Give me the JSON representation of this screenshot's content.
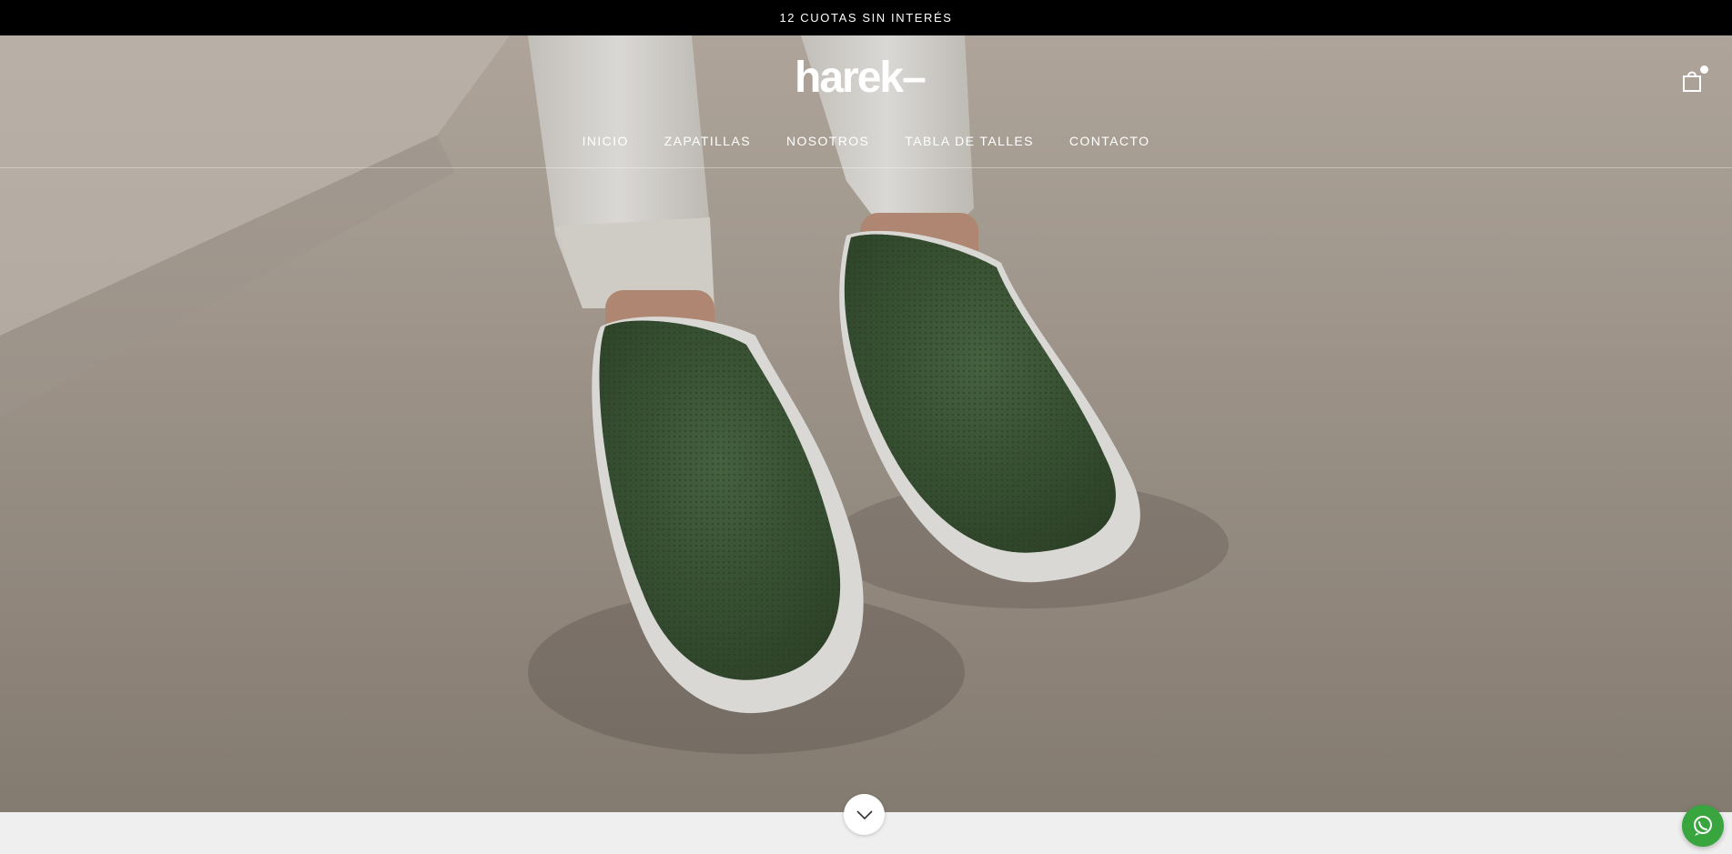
{
  "announcement": {
    "text": "12 CUOTAS SIN INTERÉS"
  },
  "header": {
    "logo_text": "harek–",
    "nav": [
      {
        "label": "INICIO"
      },
      {
        "label": "ZAPATILLAS"
      },
      {
        "label": "NOSOTROS"
      },
      {
        "label": "TABLA DE TALLES"
      },
      {
        "label": "CONTACTO"
      }
    ],
    "cart_icon": "shopping-bag-icon"
  },
  "hero": {
    "image": "green knit slip-on sneakers on feet, white cuffed trousers",
    "scroll_icon": "chevron-down-icon"
  },
  "floating": {
    "whatsapp_icon": "whatsapp-icon"
  },
  "colors": {
    "topbar": "#000000",
    "shoe_green": "#3f5a3a",
    "whatsapp": "#38a53e",
    "background": "#efefef"
  }
}
